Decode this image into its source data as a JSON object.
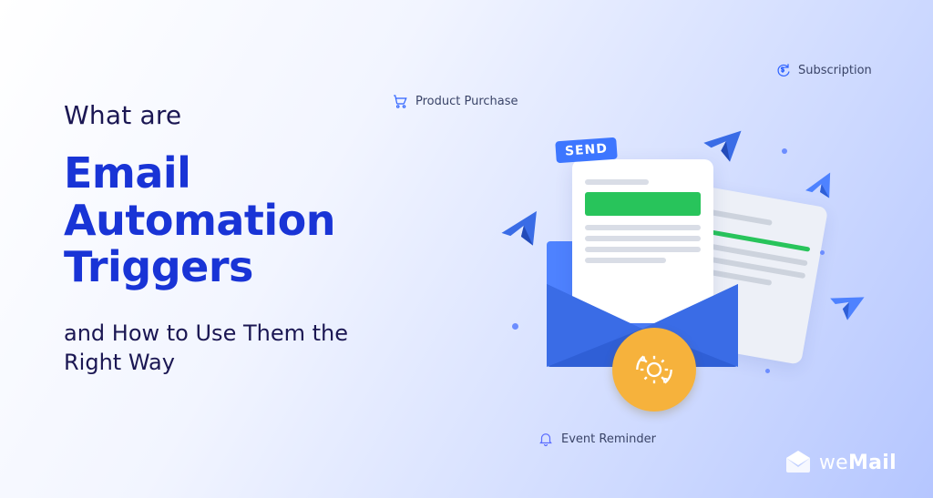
{
  "headline": {
    "lead": "What are",
    "title": "Email Automation Triggers",
    "sub": "and How to Use Them the Right Way"
  },
  "tags": {
    "product": "Product Purchase",
    "subscription": "Subscription",
    "event": "Event Reminder"
  },
  "badge": {
    "send": "SEND"
  },
  "brand": {
    "prefix": "we",
    "suffix": "Mail"
  }
}
